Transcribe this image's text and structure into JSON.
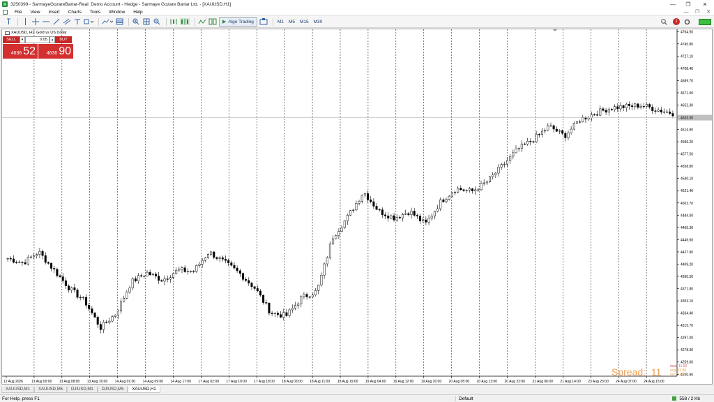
{
  "window": {
    "title": "3250399 - SarmayeGozareBartar-Real: Demo Account - Hedge - Sarmaye Gozare Bartar Ltd. - [XAUUSD,H1]",
    "min_glyph": "—",
    "max_glyph": "❐",
    "close_glyph": "✕"
  },
  "menu": {
    "items": [
      "File",
      "View",
      "Insert",
      "Charts",
      "Tools",
      "Window",
      "Help"
    ],
    "mdi_min": "—",
    "mdi_restore": "❐",
    "mdi_close": "✕"
  },
  "toolbar": {
    "algo_label": "Algo Trading",
    "timeframes": [
      "M1",
      "M5",
      "M15",
      "M30"
    ],
    "notification_count": "1"
  },
  "chart": {
    "symbol_line": "XAUUSD, H1:  Gold vs US Dollar",
    "trading_panel": {
      "sell_label": "SELL",
      "buy_label": "BUY",
      "volume": "0.05",
      "sell_price_small": "4636",
      "sell_price_big": "52",
      "buy_price_small": "4636",
      "buy_price_big": "90"
    },
    "spread_label": "Spread:",
    "spread_value": "11",
    "spread_stats": {
      "max": "max: 11.00",
      "avg": "avg: 11.00",
      "min": "min: 11.00"
    },
    "current_price_label": "4633.00"
  },
  "chart_data": {
    "type": "candlestick",
    "symbol": "XAUUSD",
    "timeframe": "H1",
    "ylim": [
      4238,
      4768
    ],
    "y_ticks": [
      4764.5,
      4745.8,
      4727.1,
      4708.4,
      4689.7,
      4671.0,
      4652.3,
      4633.6,
      4614.9,
      4596.2,
      4577.5,
      4558.8,
      4540.1,
      4521.4,
      4502.7,
      4484.0,
      4465.3,
      4446.6,
      4427.9,
      4409.2,
      4390.5,
      4371.8,
      4353.1,
      4334.4,
      4315.7,
      4297.0,
      4278.3,
      4259.6,
      4240.9
    ],
    "x_labels": [
      "12 Aug 2026",
      "13 Aug 00:00",
      "13 Aug 08:00",
      "13 Aug 16:00",
      "14 Aug 01:00",
      "14 Aug 09:00",
      "14 Aug 17:00",
      "17 Aug 02:00",
      "17 Aug 10:00",
      "17 Aug 18:00",
      "18 Aug 03:00",
      "18 Aug 11:00",
      "18 Aug 19:00",
      "19 Aug 04:00",
      "19 Aug 12:00",
      "19 Aug 20:00",
      "20 Aug 05:00",
      "20 Aug 13:00",
      "20 Aug 22:00",
      "21 Aug 06:00",
      "21 Aug 14:00",
      "23 Aug 23:00",
      "24 Aug 07:00",
      "24 Aug 15:00"
    ],
    "key_closes": [
      4418,
      4411,
      4428,
      4400,
      4372,
      4352,
      4312,
      4334,
      4382,
      4396,
      4385,
      4400,
      4398,
      4428,
      4412,
      4395,
      4372,
      4335,
      4330,
      4358,
      4368,
      4450,
      4482,
      4520,
      4490,
      4480,
      4490,
      4470,
      4505,
      4525,
      4520,
      4535,
      4560,
      4585,
      4600,
      4620,
      4605,
      4630,
      4640,
      4648,
      4650,
      4652,
      4645,
      4640
    ],
    "candle_count": 230,
    "current_price": 4633.0,
    "period_separators": true,
    "grid": false,
    "colors": {
      "bull_fill": "#ffffff",
      "bear_fill": "#000000",
      "separator": "#000000",
      "price_line": "#c0c0c0"
    }
  },
  "tabs": [
    "XAUUSD,M1",
    "XAUUSD,M5",
    "DJIUSD,M1",
    "DJIUSD,M5",
    "XAUUSD,H1"
  ],
  "status": {
    "help": "For Help, press F1",
    "profile": "Default",
    "traffic": "558 / 2 Kb"
  }
}
